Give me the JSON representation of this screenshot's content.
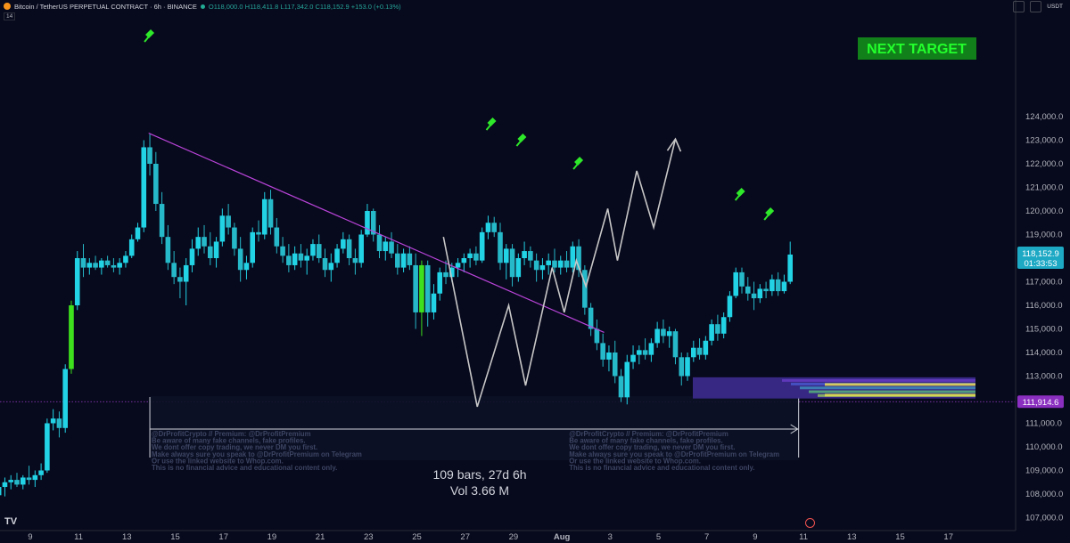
{
  "header": {
    "symbol": "Bitcoin / TetherUS PERPETUAL CONTRACT · 6h · BINANCE",
    "ohlc": "O118,000.0 H118,411.8 L117,342.0 C118,152.9 +153.0 (+0.13%)",
    "indicator": "14",
    "currency": "USDT"
  },
  "colors": {
    "bg": "#07091c",
    "bull": "#22d3e6",
    "bear": "#26b9c9",
    "highlight": "#3ee01e",
    "trend": "#b844d8",
    "projection": "#c7c7c7",
    "price_tag": "#1da8c4",
    "level_tag": "#8a2fbf"
  },
  "chart_data": {
    "type": "candlestick",
    "symbol": "BTCUSDT.P",
    "timeframe": "6h",
    "ylim": [
      106700,
      124800
    ],
    "y_ticks": [
      107000,
      108000,
      109000,
      110000,
      111000,
      112000,
      113000,
      114000,
      115000,
      116000,
      117000,
      118000,
      119000,
      120000,
      121000,
      122000,
      123000,
      124000
    ],
    "x_ticks": [
      "9",
      "11",
      "13",
      "15",
      "17",
      "19",
      "21",
      "23",
      "25",
      "27",
      "29",
      "Aug",
      "3",
      "5",
      "7",
      "9",
      "11",
      "13",
      "15",
      "17"
    ],
    "price_label": "118,152.9",
    "countdown": "01:33:53",
    "level_label": "111,914.6",
    "level": 111914.6,
    "annotation_target": "NEXT TARGET",
    "measure_text": [
      "109 bars, 27d 6h",
      "Vol 3.66 M"
    ],
    "watermark": [
      "@DrProfitCrypto // Premium: @DrProfitPremium",
      "Be aware of many fake channels, fake profiles.",
      "We dont offer copy trading, we never DM you first.",
      "Make always sure you speak to @DrProfitPremium on Telegram",
      "Or use the linked website to Whop.com.",
      "This is no financial advice and educational content only."
    ],
    "trendline": [
      [
        13.9,
        123300
      ],
      [
        32.75,
        114850
      ]
    ],
    "projection_path": [
      [
        26.1,
        118900
      ],
      [
        27.5,
        111700
      ],
      [
        28.8,
        116000
      ],
      [
        29.5,
        112600
      ],
      [
        30.6,
        117600
      ],
      [
        31.1,
        115700
      ],
      [
        31.6,
        117900
      ],
      [
        32.0,
        116800
      ],
      [
        32.9,
        120100
      ],
      [
        33.3,
        117900
      ],
      [
        34.1,
        121700
      ],
      [
        34.8,
        119300
      ],
      [
        35.7,
        123050
      ]
    ],
    "candles": [
      {
        "t": 7.7,
        "o": 107950,
        "h": 108600,
        "l": 107450,
        "c": 108300
      },
      {
        "t": 7.95,
        "o": 108300,
        "h": 108700,
        "l": 107900,
        "c": 108500
      },
      {
        "t": 8.2,
        "o": 108500,
        "h": 108800,
        "l": 108200,
        "c": 108600
      },
      {
        "t": 8.45,
        "o": 108600,
        "h": 108900,
        "l": 108300,
        "c": 108400
      },
      {
        "t": 8.7,
        "o": 108400,
        "h": 108800,
        "l": 108200,
        "c": 108700
      },
      {
        "t": 8.95,
        "o": 108700,
        "h": 109200,
        "l": 108400,
        "c": 108600
      },
      {
        "t": 9.2,
        "o": 108600,
        "h": 109000,
        "l": 108300,
        "c": 108800
      },
      {
        "t": 9.45,
        "o": 108800,
        "h": 109300,
        "l": 108600,
        "c": 109000
      },
      {
        "t": 9.7,
        "o": 109000,
        "h": 111200,
        "l": 108900,
        "c": 111000
      },
      {
        "t": 9.95,
        "o": 111000,
        "h": 111600,
        "l": 110700,
        "c": 111200
      },
      {
        "t": 10.2,
        "o": 111200,
        "h": 111500,
        "l": 110400,
        "c": 110800
      },
      {
        "t": 10.45,
        "o": 110800,
        "h": 113500,
        "l": 110600,
        "c": 113300
      },
      {
        "t": 10.7,
        "o": 113300,
        "h": 116200,
        "l": 113100,
        "c": 116000,
        "hl": true
      },
      {
        "t": 10.95,
        "o": 116000,
        "h": 118300,
        "l": 115800,
        "c": 118000
      },
      {
        "t": 11.2,
        "o": 118000,
        "h": 118600,
        "l": 117200,
        "c": 117600
      },
      {
        "t": 11.45,
        "o": 117600,
        "h": 118000,
        "l": 117300,
        "c": 117800
      },
      {
        "t": 11.7,
        "o": 117800,
        "h": 118100,
        "l": 117500,
        "c": 117600
      },
      {
        "t": 11.95,
        "o": 117600,
        "h": 118000,
        "l": 117300,
        "c": 117900
      },
      {
        "t": 12.2,
        "o": 117900,
        "h": 118100,
        "l": 117600,
        "c": 117700
      },
      {
        "t": 12.45,
        "o": 117700,
        "h": 118000,
        "l": 117400,
        "c": 117600
      },
      {
        "t": 12.7,
        "o": 117600,
        "h": 118000,
        "l": 117300,
        "c": 117800
      },
      {
        "t": 12.95,
        "o": 117800,
        "h": 118300,
        "l": 117600,
        "c": 118100
      },
      {
        "t": 13.2,
        "o": 118100,
        "h": 119000,
        "l": 118000,
        "c": 118800
      },
      {
        "t": 13.45,
        "o": 118800,
        "h": 119500,
        "l": 118700,
        "c": 119300
      },
      {
        "t": 13.7,
        "o": 119300,
        "h": 123000,
        "l": 119100,
        "c": 122700
      },
      {
        "t": 13.95,
        "o": 122700,
        "h": 123250,
        "l": 121500,
        "c": 122000
      },
      {
        "t": 14.2,
        "o": 122000,
        "h": 122500,
        "l": 120000,
        "c": 120300
      },
      {
        "t": 14.45,
        "o": 120300,
        "h": 120800,
        "l": 118600,
        "c": 118900
      },
      {
        "t": 14.7,
        "o": 118900,
        "h": 119400,
        "l": 117500,
        "c": 117800
      },
      {
        "t": 14.95,
        "o": 117800,
        "h": 118300,
        "l": 116900,
        "c": 117200
      },
      {
        "t": 15.2,
        "o": 117200,
        "h": 117600,
        "l": 116300,
        "c": 117000
      },
      {
        "t": 15.45,
        "o": 117000,
        "h": 118000,
        "l": 116000,
        "c": 117700
      },
      {
        "t": 15.7,
        "o": 117700,
        "h": 118800,
        "l": 117400,
        "c": 118400
      },
      {
        "t": 15.95,
        "o": 118400,
        "h": 119300,
        "l": 118100,
        "c": 118900
      },
      {
        "t": 16.2,
        "o": 118900,
        "h": 119400,
        "l": 118200,
        "c": 118500
      },
      {
        "t": 16.45,
        "o": 118500,
        "h": 119100,
        "l": 117700,
        "c": 118000
      },
      {
        "t": 16.7,
        "o": 118000,
        "h": 118900,
        "l": 117600,
        "c": 118700
      },
      {
        "t": 16.95,
        "o": 118700,
        "h": 120100,
        "l": 118500,
        "c": 119800
      },
      {
        "t": 17.2,
        "o": 119800,
        "h": 120300,
        "l": 119000,
        "c": 119300
      },
      {
        "t": 17.45,
        "o": 119300,
        "h": 119500,
        "l": 118100,
        "c": 118400
      },
      {
        "t": 17.7,
        "o": 118400,
        "h": 118900,
        "l": 117000,
        "c": 117500
      },
      {
        "t": 17.95,
        "o": 117500,
        "h": 118100,
        "l": 117100,
        "c": 117800
      },
      {
        "t": 18.2,
        "o": 117800,
        "h": 119300,
        "l": 117600,
        "c": 119100
      },
      {
        "t": 18.45,
        "o": 119100,
        "h": 119600,
        "l": 118700,
        "c": 119000
      },
      {
        "t": 18.7,
        "o": 119000,
        "h": 120800,
        "l": 118800,
        "c": 120500
      },
      {
        "t": 18.95,
        "o": 120500,
        "h": 120900,
        "l": 119000,
        "c": 119300
      },
      {
        "t": 19.2,
        "o": 119300,
        "h": 119700,
        "l": 118200,
        "c": 118500
      },
      {
        "t": 19.45,
        "o": 118500,
        "h": 118900,
        "l": 117800,
        "c": 118100
      },
      {
        "t": 19.7,
        "o": 118100,
        "h": 118600,
        "l": 117400,
        "c": 117700
      },
      {
        "t": 19.95,
        "o": 117700,
        "h": 118500,
        "l": 117500,
        "c": 118200
      },
      {
        "t": 20.2,
        "o": 118200,
        "h": 118600,
        "l": 117600,
        "c": 117900
      },
      {
        "t": 20.45,
        "o": 117900,
        "h": 118400,
        "l": 117300,
        "c": 118100
      },
      {
        "t": 20.7,
        "o": 118100,
        "h": 118800,
        "l": 117900,
        "c": 118600
      },
      {
        "t": 20.95,
        "o": 118600,
        "h": 119000,
        "l": 117800,
        "c": 118000
      },
      {
        "t": 21.2,
        "o": 118000,
        "h": 118400,
        "l": 117200,
        "c": 117500
      },
      {
        "t": 21.45,
        "o": 117500,
        "h": 118200,
        "l": 117000,
        "c": 117800
      },
      {
        "t": 21.7,
        "o": 117800,
        "h": 118600,
        "l": 117600,
        "c": 118400
      },
      {
        "t": 21.95,
        "o": 118400,
        "h": 119100,
        "l": 118200,
        "c": 118800
      },
      {
        "t": 22.2,
        "o": 118800,
        "h": 119000,
        "l": 117700,
        "c": 118000
      },
      {
        "t": 22.45,
        "o": 118000,
        "h": 118400,
        "l": 117300,
        "c": 117800
      },
      {
        "t": 22.7,
        "o": 117800,
        "h": 119200,
        "l": 117600,
        "c": 119000
      },
      {
        "t": 22.95,
        "o": 119000,
        "h": 120300,
        "l": 118900,
        "c": 120000
      },
      {
        "t": 23.2,
        "o": 120000,
        "h": 120100,
        "l": 118700,
        "c": 119000
      },
      {
        "t": 23.45,
        "o": 119000,
        "h": 119400,
        "l": 118000,
        "c": 118300
      },
      {
        "t": 23.7,
        "o": 118300,
        "h": 118900,
        "l": 117900,
        "c": 118700
      },
      {
        "t": 23.95,
        "o": 118700,
        "h": 119100,
        "l": 118000,
        "c": 118200
      },
      {
        "t": 24.2,
        "o": 118200,
        "h": 118600,
        "l": 117300,
        "c": 117600
      },
      {
        "t": 24.45,
        "o": 117600,
        "h": 118400,
        "l": 117400,
        "c": 118200
      },
      {
        "t": 24.7,
        "o": 118200,
        "h": 118500,
        "l": 117500,
        "c": 117700
      },
      {
        "t": 24.95,
        "o": 117700,
        "h": 118200,
        "l": 115000,
        "c": 115700
      },
      {
        "t": 25.2,
        "o": 115700,
        "h": 117900,
        "l": 114700,
        "c": 117700,
        "hl": true
      },
      {
        "t": 25.45,
        "o": 117700,
        "h": 117900,
        "l": 115100,
        "c": 115700
      },
      {
        "t": 25.7,
        "o": 115700,
        "h": 116900,
        "l": 115400,
        "c": 116500
      },
      {
        "t": 25.95,
        "o": 116500,
        "h": 117600,
        "l": 116200,
        "c": 117400
      },
      {
        "t": 26.2,
        "o": 117400,
        "h": 117900,
        "l": 116900,
        "c": 117200
      },
      {
        "t": 26.45,
        "o": 117200,
        "h": 117800,
        "l": 117000,
        "c": 117600
      },
      {
        "t": 26.7,
        "o": 117600,
        "h": 118000,
        "l": 117200,
        "c": 117800
      },
      {
        "t": 26.95,
        "o": 117800,
        "h": 118200,
        "l": 117400,
        "c": 118000
      },
      {
        "t": 27.2,
        "o": 118000,
        "h": 118400,
        "l": 117600,
        "c": 118200
      },
      {
        "t": 27.45,
        "o": 118200,
        "h": 118500,
        "l": 117700,
        "c": 117900
      },
      {
        "t": 27.7,
        "o": 117900,
        "h": 119300,
        "l": 117800,
        "c": 119100
      },
      {
        "t": 27.95,
        "o": 119100,
        "h": 119800,
        "l": 118800,
        "c": 119500
      },
      {
        "t": 28.2,
        "o": 119500,
        "h": 119750,
        "l": 118900,
        "c": 119100
      },
      {
        "t": 28.45,
        "o": 119100,
        "h": 119500,
        "l": 117500,
        "c": 117800
      },
      {
        "t": 28.7,
        "o": 117800,
        "h": 118600,
        "l": 117100,
        "c": 118400
      },
      {
        "t": 28.95,
        "o": 118400,
        "h": 118600,
        "l": 116800,
        "c": 117200
      },
      {
        "t": 29.2,
        "o": 117200,
        "h": 118200,
        "l": 117000,
        "c": 118000
      },
      {
        "t": 29.45,
        "o": 118000,
        "h": 118700,
        "l": 117700,
        "c": 118300
      },
      {
        "t": 29.7,
        "o": 118300,
        "h": 118500,
        "l": 117600,
        "c": 117900
      },
      {
        "t": 29.95,
        "o": 117900,
        "h": 118200,
        "l": 117000,
        "c": 117500
      },
      {
        "t": 30.2,
        "o": 117500,
        "h": 118000,
        "l": 117100,
        "c": 117700
      },
      {
        "t": 30.45,
        "o": 117700,
        "h": 118200,
        "l": 117300,
        "c": 117900
      },
      {
        "t": 30.7,
        "o": 117900,
        "h": 118400,
        "l": 117400,
        "c": 117600
      },
      {
        "t": 30.95,
        "o": 117600,
        "h": 118100,
        "l": 117300,
        "c": 117900
      },
      {
        "t": 31.2,
        "o": 117900,
        "h": 118300,
        "l": 117400,
        "c": 117600
      },
      {
        "t": 31.45,
        "o": 117600,
        "h": 118700,
        "l": 117400,
        "c": 118500
      },
      {
        "t": 31.7,
        "o": 118500,
        "h": 118800,
        "l": 117200,
        "c": 117500
      },
      {
        "t": 31.95,
        "o": 117500,
        "h": 117700,
        "l": 115600,
        "c": 115900
      },
      {
        "t": 32.2,
        "o": 115900,
        "h": 116100,
        "l": 114700,
        "c": 115000
      },
      {
        "t": 32.45,
        "o": 115000,
        "h": 115400,
        "l": 114100,
        "c": 114400
      },
      {
        "t": 32.7,
        "o": 114400,
        "h": 114800,
        "l": 113400,
        "c": 113700
      },
      {
        "t": 32.95,
        "o": 113700,
        "h": 114300,
        "l": 113200,
        "c": 114000
      },
      {
        "t": 33.2,
        "o": 114000,
        "h": 114500,
        "l": 112700,
        "c": 113000
      },
      {
        "t": 33.45,
        "o": 113000,
        "h": 113300,
        "l": 111900,
        "c": 112100
      },
      {
        "t": 33.7,
        "o": 112100,
        "h": 113900,
        "l": 111800,
        "c": 113600
      },
      {
        "t": 33.95,
        "o": 113600,
        "h": 114300,
        "l": 113300,
        "c": 113900
      },
      {
        "t": 34.2,
        "o": 113900,
        "h": 114300,
        "l": 113500,
        "c": 114100
      },
      {
        "t": 34.45,
        "o": 114100,
        "h": 114600,
        "l": 113700,
        "c": 113900
      },
      {
        "t": 34.7,
        "o": 113900,
        "h": 114600,
        "l": 113600,
        "c": 114400
      },
      {
        "t": 34.95,
        "o": 114400,
        "h": 115300,
        "l": 114200,
        "c": 115000
      },
      {
        "t": 35.2,
        "o": 115000,
        "h": 115400,
        "l": 114400,
        "c": 114700
      },
      {
        "t": 35.45,
        "o": 114700,
        "h": 115100,
        "l": 114200,
        "c": 114900
      },
      {
        "t": 35.7,
        "o": 114900,
        "h": 115000,
        "l": 113500,
        "c": 113800
      },
      {
        "t": 35.95,
        "o": 113800,
        "h": 114000,
        "l": 112600,
        "c": 113000
      },
      {
        "t": 36.2,
        "o": 113000,
        "h": 114000,
        "l": 112800,
        "c": 113800
      },
      {
        "t": 36.45,
        "o": 113800,
        "h": 114500,
        "l": 113600,
        "c": 114200
      },
      {
        "t": 36.7,
        "o": 114200,
        "h": 114600,
        "l": 113700,
        "c": 113900
      },
      {
        "t": 36.95,
        "o": 113900,
        "h": 114700,
        "l": 113700,
        "c": 114500
      },
      {
        "t": 37.2,
        "o": 114500,
        "h": 115400,
        "l": 114300,
        "c": 115200
      },
      {
        "t": 37.45,
        "o": 115200,
        "h": 115600,
        "l": 114500,
        "c": 114800
      },
      {
        "t": 37.7,
        "o": 114800,
        "h": 115700,
        "l": 114600,
        "c": 115500
      },
      {
        "t": 37.95,
        "o": 115500,
        "h": 116600,
        "l": 115300,
        "c": 116400
      },
      {
        "t": 38.2,
        "o": 116400,
        "h": 117600,
        "l": 116300,
        "c": 117400
      },
      {
        "t": 38.45,
        "o": 117400,
        "h": 117600,
        "l": 116500,
        "c": 116800
      },
      {
        "t": 38.7,
        "o": 116800,
        "h": 117200,
        "l": 116200,
        "c": 116500
      },
      {
        "t": 38.95,
        "o": 116500,
        "h": 117000,
        "l": 115800,
        "c": 116300
      },
      {
        "t": 39.2,
        "o": 116300,
        "h": 116900,
        "l": 116100,
        "c": 116700
      },
      {
        "t": 39.45,
        "o": 116700,
        "h": 117000,
        "l": 116300,
        "c": 116600
      },
      {
        "t": 39.7,
        "o": 116600,
        "h": 117300,
        "l": 116400,
        "c": 117100
      },
      {
        "t": 39.95,
        "o": 117100,
        "h": 117400,
        "l": 116400,
        "c": 116600
      },
      {
        "t": 40.2,
        "o": 116600,
        "h": 117300,
        "l": 116500,
        "c": 117000
      },
      {
        "t": 40.45,
        "o": 117000,
        "h": 118700,
        "l": 116900,
        "c": 118153
      }
    ]
  }
}
